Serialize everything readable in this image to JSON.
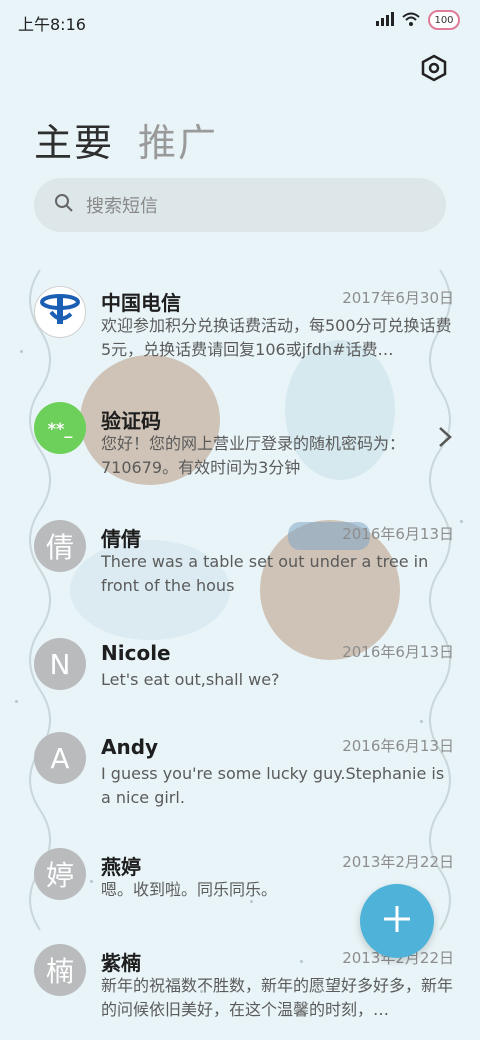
{
  "status": {
    "time": "上午8:16",
    "battery": "100"
  },
  "header": {
    "tab_main": "主要",
    "tab_promo": "推广"
  },
  "search": {
    "placeholder": "搜索短信"
  },
  "messages": [
    {
      "sender": "中国电信",
      "date": "2017年6月30日",
      "preview": "欢迎参加积分兑换话费活动，每500分可兑换话费5元，兑换话费请回复106或jfdh#话费…",
      "avatar": "china-telecom-logo"
    },
    {
      "sender": "验证码",
      "date": "",
      "preview": "您好！您的网上营业厅登录的随机密码为：710679。有效时间为3分钟",
      "avatar_text": "**_"
    },
    {
      "sender": "倩倩",
      "date": "2016年6月13日",
      "preview": "There was a table set out under a tree in front of the hous",
      "avatar_text": "倩"
    },
    {
      "sender": "Nicole",
      "date": "2016年6月13日",
      "preview": "Let's eat out,shall we?",
      "avatar_text": "N"
    },
    {
      "sender": "Andy",
      "date": "2016年6月13日",
      "preview": "I guess you're some lucky guy.Stephanie is a nice girl.",
      "avatar_text": "A"
    },
    {
      "sender": "燕婷",
      "date": "2013年2月22日",
      "preview": "嗯。收到啦。同乐同乐。",
      "avatar_text": "婷"
    },
    {
      "sender": "紫楠",
      "date": "2013年2月22日",
      "preview": "新年的祝福数不胜数，新年的愿望好多好多，新年的问候依旧美好，在这个温馨的时刻，…",
      "avatar_text": "楠"
    }
  ],
  "colors": {
    "accent": "#4fb3d9",
    "verify_avatar": "#6cd05a",
    "telecom_blue": "#1a5fb4"
  }
}
